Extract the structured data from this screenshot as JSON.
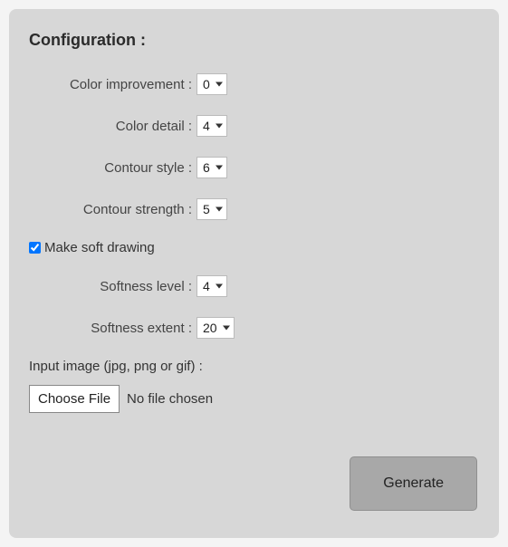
{
  "title": "Configuration :",
  "fields": {
    "color_improvement": {
      "label": "Color improvement :",
      "value": "0"
    },
    "color_detail": {
      "label": "Color detail :",
      "value": "4"
    },
    "contour_style": {
      "label": "Contour style :",
      "value": "6"
    },
    "contour_strength": {
      "label": "Contour strength :",
      "value": "5"
    },
    "softness_level": {
      "label": "Softness level :",
      "value": "4"
    },
    "softness_extent": {
      "label": "Softness extent :",
      "value": "20"
    }
  },
  "soft_drawing": {
    "label": "Make soft drawing",
    "checked": true
  },
  "file_input": {
    "label": "Input image (jpg, png or gif) :",
    "button": "Choose File",
    "status": "No file chosen"
  },
  "generate_label": "Generate"
}
